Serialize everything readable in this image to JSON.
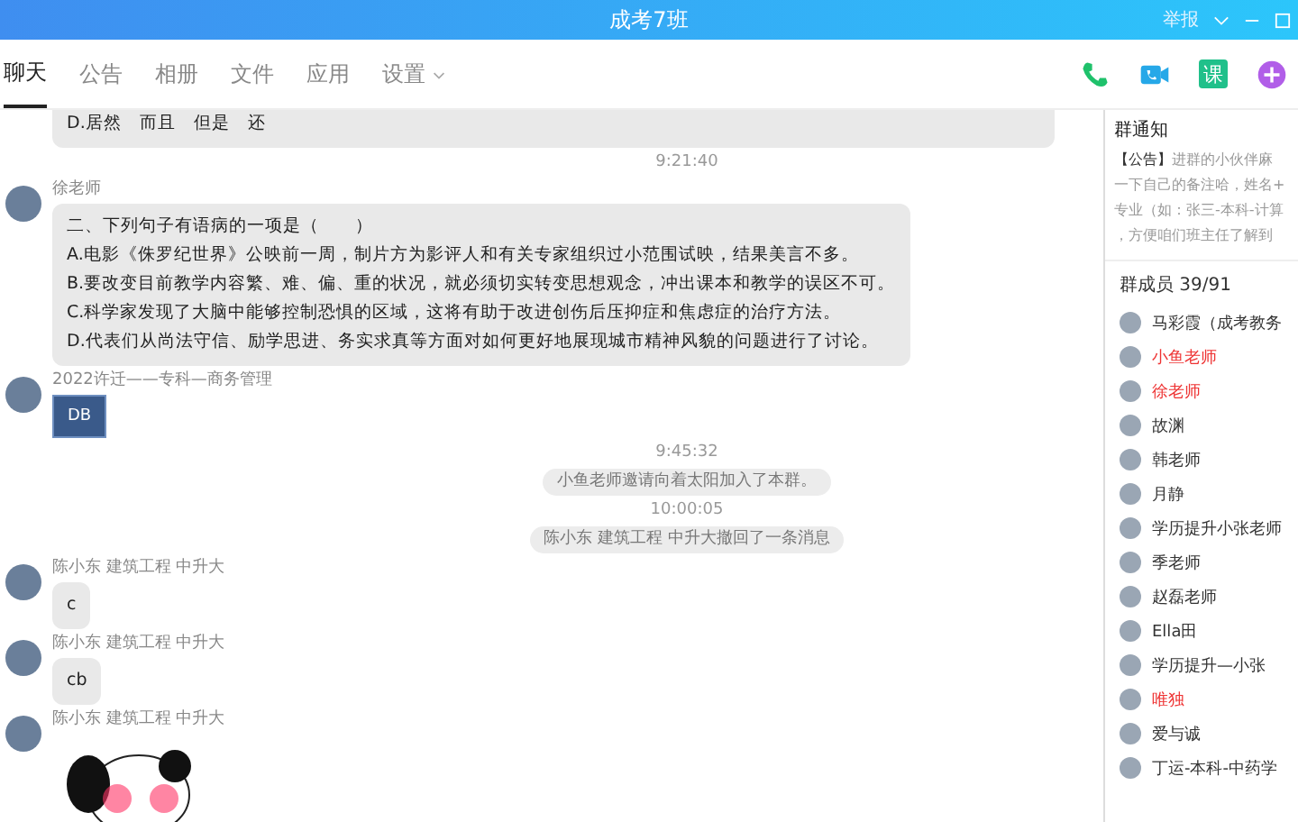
{
  "window": {
    "title": "成考7班",
    "report": "举报"
  },
  "tabs": [
    {
      "label": "聊天",
      "selected": true
    },
    {
      "label": "公告",
      "selected": false
    },
    {
      "label": "相册",
      "selected": false
    },
    {
      "label": "文件",
      "selected": false
    },
    {
      "label": "应用",
      "selected": false
    },
    {
      "label": "设置",
      "selected": false,
      "dropdown": true
    }
  ],
  "toolbar": {
    "course_label": "课"
  },
  "messages": [
    {
      "kind": "text",
      "lines": [
        "D.居然　而且　但是　还"
      ]
    },
    {
      "kind": "time",
      "text": "9:21:40"
    },
    {
      "kind": "text",
      "sender": "徐老师",
      "lines": [
        "二、下列句子有语病的一项是（　　）",
        "A.电影《侏罗纪世界》公映前一周，制片方为影评人和有关专家组织过小范围试映，结果美言不多。",
        "B.要改变目前教学内容繁、难、偏、重的状况，就必须切实转变思想观念，冲出课本和教学的误区不可。",
        "C.科学家发现了大脑中能够控制恐惧的区域，这将有助于改进创伤后压抑症和焦虑症的治疗方法。",
        "D.代表们从尚法守信、励学思进、务实求真等方面对如何更好地展现城市精神风貌的问题进行了讨论。"
      ]
    },
    {
      "kind": "file",
      "sender": "2022许迁——专科—商务管理",
      "label": "DB"
    },
    {
      "kind": "time",
      "text": "9:45:32"
    },
    {
      "kind": "system",
      "text": "小鱼老师邀请向着太阳加入了本群。"
    },
    {
      "kind": "time",
      "text": "10:00:05"
    },
    {
      "kind": "system",
      "text": "陈小东 建筑工程 中升大撤回了一条消息"
    },
    {
      "kind": "text",
      "sender": "陈小东 建筑工程 中升大",
      "lines": [
        "c"
      ]
    },
    {
      "kind": "text",
      "sender": "陈小东 建筑工程 中升大",
      "lines": [
        "cb"
      ]
    },
    {
      "kind": "image",
      "sender": "陈小东 建筑工程 中升大"
    }
  ],
  "notice": {
    "title": "群通知",
    "tag": "【公告】",
    "lines": [
      "进群的小伙伴麻",
      "一下自己的备注哈，姓名+",
      "专业（如：张三-本科-计算",
      "，方便咱们班主任了解到"
    ]
  },
  "members": {
    "title": "群成员 39/91",
    "items": [
      {
        "name": "马彩霞（成考教务",
        "highlighted": false
      },
      {
        "name": "小鱼老师",
        "highlighted": true
      },
      {
        "name": "徐老师",
        "highlighted": true
      },
      {
        "name": "故渊",
        "highlighted": false
      },
      {
        "name": "韩老师",
        "highlighted": false
      },
      {
        "name": "月静",
        "highlighted": false
      },
      {
        "name": "学历提升小张老师",
        "highlighted": false
      },
      {
        "name": "季老师",
        "highlighted": false
      },
      {
        "name": "赵磊老师",
        "highlighted": false
      },
      {
        "name": "Ella田",
        "highlighted": false
      },
      {
        "name": "学历提升—小张",
        "highlighted": false
      },
      {
        "name": "唯独",
        "highlighted": true
      },
      {
        "name": "爱与诚",
        "highlighted": false
      },
      {
        "name": "丁运-本科-中药学",
        "highlighted": false
      }
    ]
  }
}
